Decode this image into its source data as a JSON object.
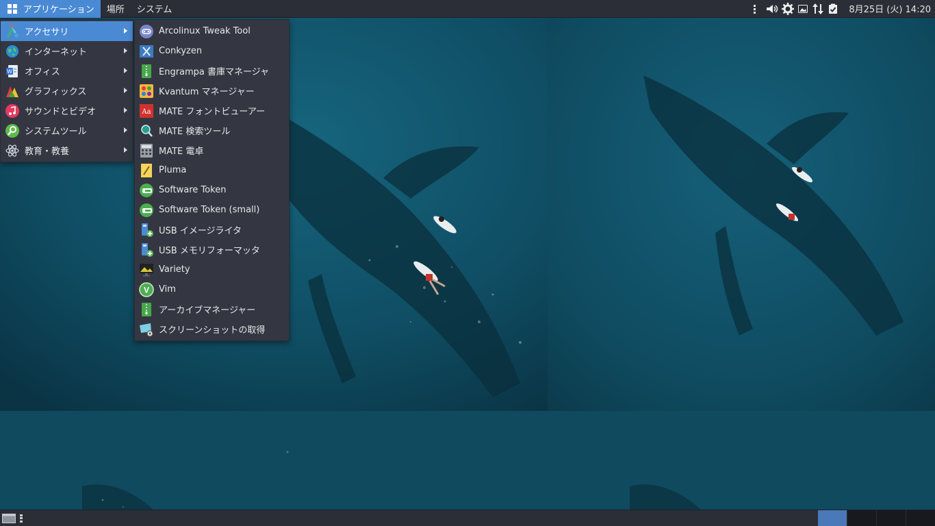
{
  "top_panel": {
    "menus": [
      "アプリケーション",
      "場所",
      "システム"
    ],
    "clock": "8月25日 (火) 14:20",
    "tray_icons": [
      "signal-icon",
      "volume-icon",
      "settings-gear-icon",
      "image-viewer-icon",
      "network-updown-icon",
      "clipboard-check-icon"
    ]
  },
  "categories": [
    {
      "label": "アクセサリ",
      "icon": "accessories-icon",
      "selected": true
    },
    {
      "label": "インターネット",
      "icon": "internet-globe-icon"
    },
    {
      "label": "オフィス",
      "icon": "office-document-icon"
    },
    {
      "label": "グラフィックス",
      "icon": "graphics-icon"
    },
    {
      "label": "サウンドとビデオ",
      "icon": "music-note-icon"
    },
    {
      "label": "システムツール",
      "icon": "system-tools-icon"
    },
    {
      "label": "教育・教養",
      "icon": "atom-icon"
    }
  ],
  "accessories": [
    {
      "label": "Arcolinux Tweak Tool",
      "icon": "tweak-tool-icon"
    },
    {
      "label": "Conkyzen",
      "icon": "conkyzen-icon"
    },
    {
      "label": "Engrampa 書庫マネージャ",
      "icon": "archive-zipper-icon"
    },
    {
      "label": "Kvantum マネージャー",
      "icon": "kvantum-palette-icon"
    },
    {
      "label": "MATE フォントビューアー",
      "icon": "font-viewer-icon"
    },
    {
      "label": "MATE 検索ツール",
      "icon": "search-tool-icon"
    },
    {
      "label": "MATE 電卓",
      "icon": "calculator-icon"
    },
    {
      "label": "Pluma",
      "icon": "pluma-editor-icon"
    },
    {
      "label": "Software Token",
      "icon": "software-token-icon"
    },
    {
      "label": "Software Token (small)",
      "icon": "software-token-small-icon"
    },
    {
      "label": "USB イメージライタ",
      "icon": "usb-image-writer-icon"
    },
    {
      "label": "USB メモリフォーマッタ",
      "icon": "usb-formatter-icon"
    },
    {
      "label": "Variety",
      "icon": "variety-wallpaper-icon"
    },
    {
      "label": "Vim",
      "icon": "vim-icon"
    },
    {
      "label": "アーカイブマネージャー",
      "icon": "archive-manager-icon"
    },
    {
      "label": "スクリーンショットの取得",
      "icon": "screenshot-icon"
    }
  ],
  "colors": {
    "panel": "#2b2e37",
    "menu_bg": "#343742",
    "accent": "#4a8ad4",
    "ocean": "#0e4a60"
  }
}
